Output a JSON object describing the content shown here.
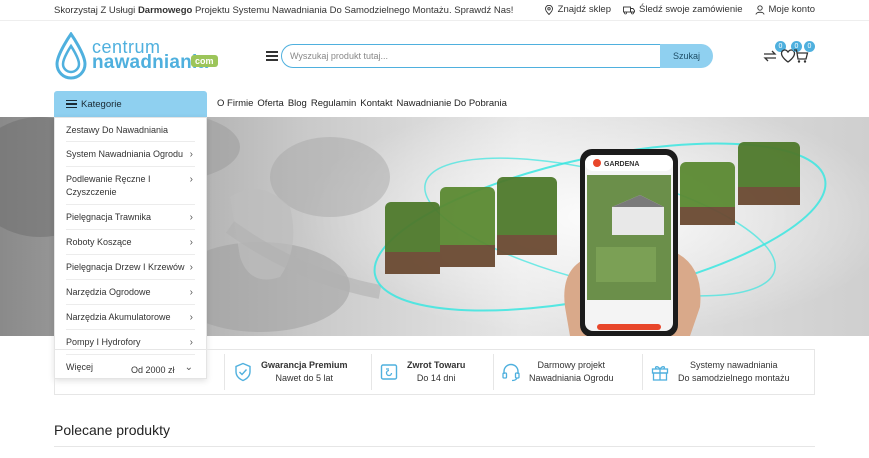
{
  "topbar": {
    "promo_pre": "Skorzystaj Z Usługi ",
    "promo_bold": "Darmowego",
    "promo_post": " Projektu Systemu Nawadniania Do Samodzielnego Montażu. Sprawdź Nas!",
    "find_store": "Znajdź sklep",
    "track_order": "Śledź swoje zamówienie",
    "my_account": "Moje konto"
  },
  "logo": {
    "line1": "centrum",
    "line2": "nawadniania",
    "badge": "com"
  },
  "search": {
    "placeholder": "Wyszukaj produkt tutaj...",
    "button": "Szukaj"
  },
  "header_icons": {
    "compare": {
      "icon": "compare-icon",
      "count": "0"
    },
    "wishlist": {
      "icon": "heart-icon",
      "count": "0"
    },
    "cart": {
      "icon": "cart-icon",
      "count": "0"
    }
  },
  "nav": {
    "categories_label": "Kategorie",
    "links": [
      "O Firmie",
      "Oferta",
      "Blog",
      "Regulamin",
      "Kontakt",
      "Nawadnianie Do Pobrania"
    ]
  },
  "categories": [
    {
      "label": "Zestawy Do Nawadniania",
      "chevron": ""
    },
    {
      "label": "System Nawadniania Ogrodu",
      "chevron": "›"
    },
    {
      "label": "Podlewanie Ręczne I Czyszczenie",
      "chevron": "›"
    },
    {
      "label": "Pielęgnacja Trawnika",
      "chevron": "›"
    },
    {
      "label": "Roboty Koszące",
      "chevron": "›"
    },
    {
      "label": "Pielęgnacja Drzew I Krzewów",
      "chevron": "›"
    },
    {
      "label": "Narzędzia Ogrodowe",
      "chevron": "›"
    },
    {
      "label": "Narzędzia Akumulatorowe",
      "chevron": "›"
    },
    {
      "label": "Pompy I Hydrofory",
      "chevron": "›"
    },
    {
      "label": "Więcej",
      "chevron": "⌄"
    }
  ],
  "hero": {
    "brand": "GARDENA"
  },
  "features": {
    "f1_line2": "Od 2000 zł",
    "f2_title": "Gwarancja Premium",
    "f2_line2": "Nawet do 5 lat",
    "f3_title": "Zwrot Towaru",
    "f3_line2": "Do 14 dni",
    "f4_line1": "Darmowy projekt",
    "f4_line2": "Nawadniania Ogrodu",
    "f5_line1": "Systemy nawadniania",
    "f5_line2": "Do samodzielnego montażu"
  },
  "section": {
    "title": "Polecane produkty"
  },
  "colors": {
    "accent": "#4fb0de",
    "accent_light": "#8fd0f0",
    "badge_green": "#9cc55a",
    "cta": "#e8462a"
  }
}
